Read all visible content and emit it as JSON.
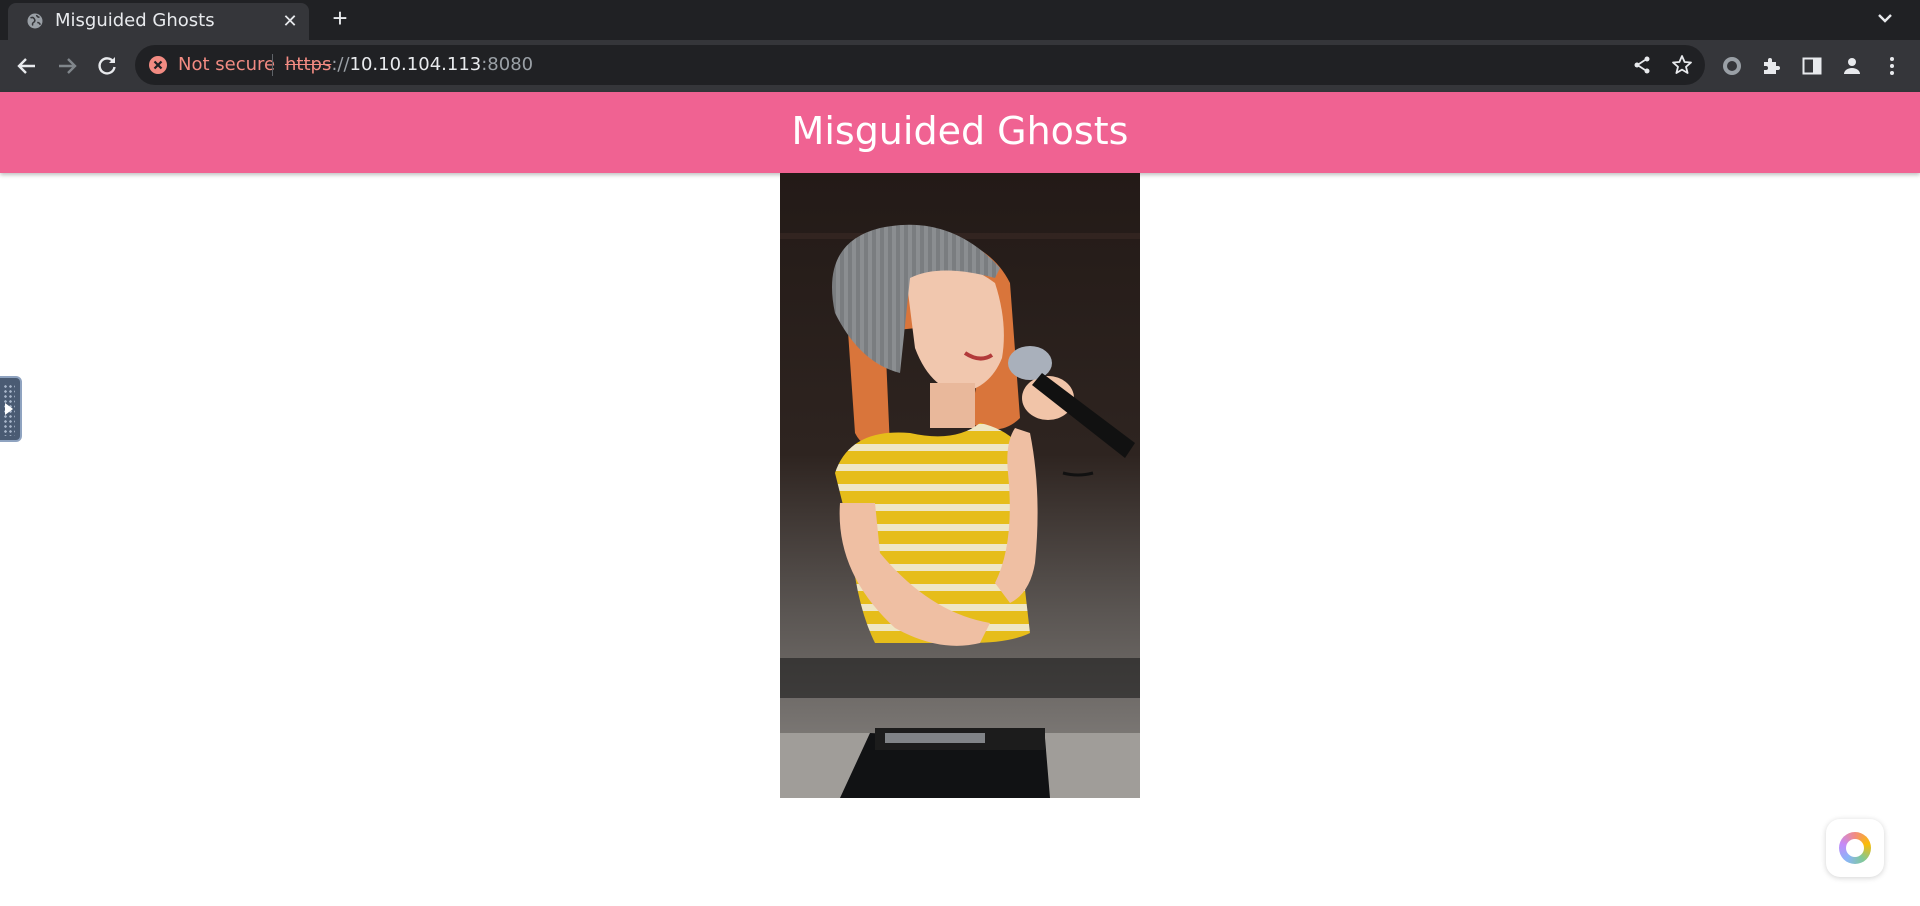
{
  "browser": {
    "tab": {
      "title": "Misguided Ghosts",
      "close_glyph": "✕"
    },
    "new_tab_glyph": "+",
    "address": {
      "security_label": "Not secure",
      "scheme": "https",
      "slashes": "://",
      "host": "10.10.104.113",
      "port": ":8080"
    },
    "icons": [
      "globe-icon",
      "back-icon",
      "forward-icon",
      "reload-icon",
      "security-warning-icon",
      "share-icon",
      "bookmark-star-icon",
      "extension-circle-icon",
      "extensions-puzzle-icon",
      "side-panel-icon",
      "profile-icon",
      "menu-kebab-icon",
      "tab-search-chevron-icon"
    ]
  },
  "page": {
    "header_title": "Misguided Ghosts",
    "header_color": "#f06292",
    "image_alt": "",
    "floating_button_icon": "color-wheel-icon",
    "side_handle_icon": "play-arrow-icon"
  }
}
